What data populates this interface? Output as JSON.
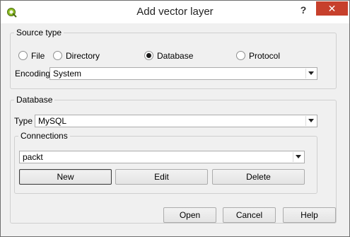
{
  "window": {
    "title": "Add vector layer",
    "help_glyph": "?",
    "close_glyph": "✕"
  },
  "source_type": {
    "label": "Source type",
    "options": [
      "File",
      "Directory",
      "Database",
      "Protocol"
    ],
    "selected": "Database",
    "encoding_label": "Encoding",
    "encoding_value": "System"
  },
  "database": {
    "label": "Database",
    "type_label": "Type",
    "type_value": "MySQL",
    "connections": {
      "label": "Connections",
      "selected": "packt",
      "new_label": "New",
      "edit_label": "Edit",
      "delete_label": "Delete"
    }
  },
  "footer": {
    "open_label": "Open",
    "cancel_label": "Cancel",
    "help_label": "Help"
  },
  "colors": {
    "close_button": "#c7402c",
    "icon_accent": "#8cbd23"
  },
  "icons": {
    "app": "qgis-icon",
    "dropdown": "chevron-down-icon"
  }
}
